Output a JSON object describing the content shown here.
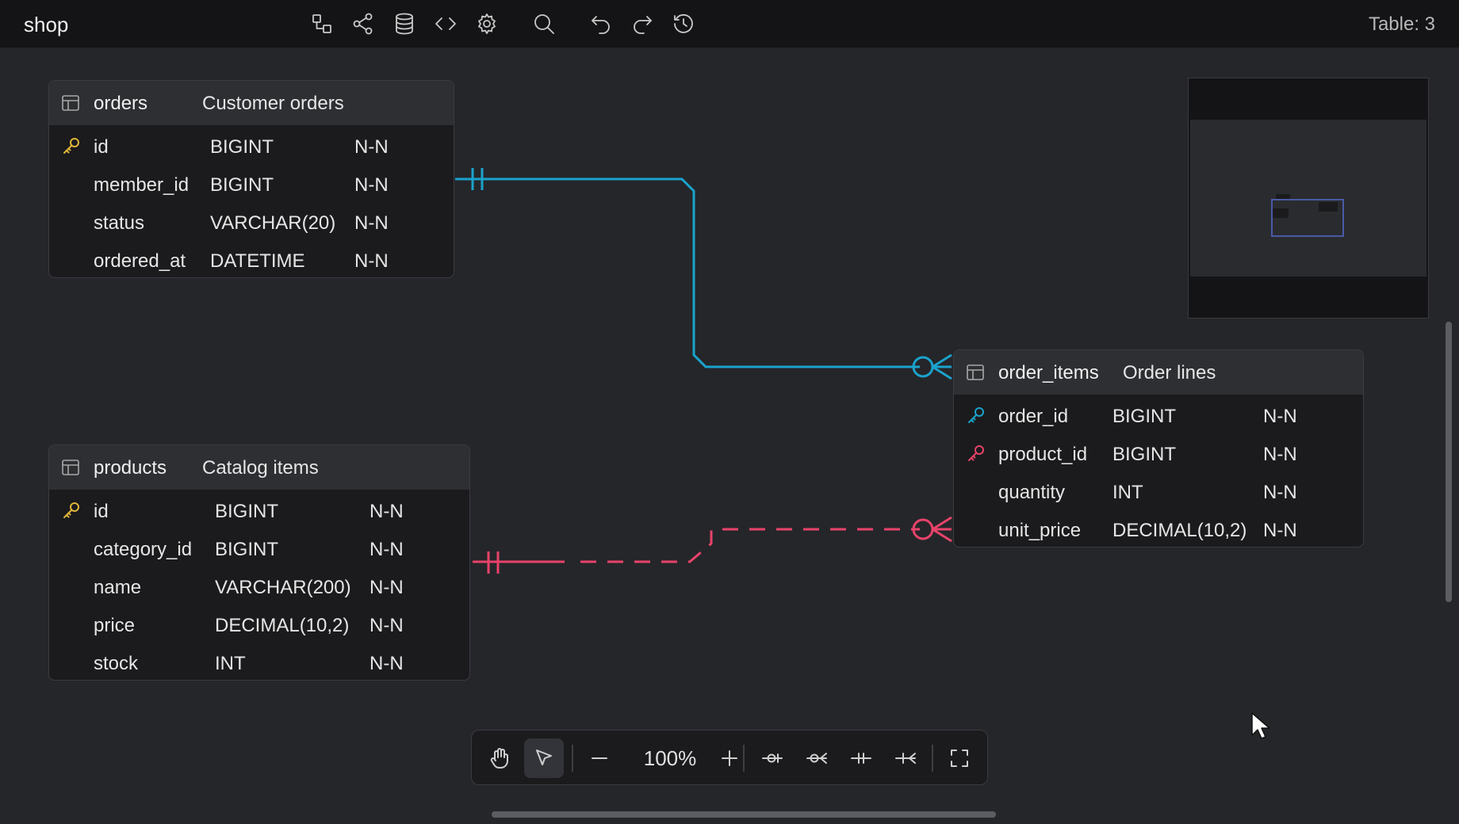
{
  "app": {
    "title": "shop",
    "table_count": "Table: 3"
  },
  "toolbar": {
    "icons": [
      "diagram-icon",
      "share-icon",
      "database-icon",
      "code-icon",
      "settings-icon",
      "search-icon",
      "undo-icon",
      "redo-icon",
      "history-icon"
    ]
  },
  "tables": {
    "orders": {
      "name": "orders",
      "comment": "Customer orders",
      "columns": [
        {
          "name": "id",
          "type": "BIGINT",
          "nullable": "N-N",
          "key": "primary"
        },
        {
          "name": "member_id",
          "type": "BIGINT",
          "nullable": "N-N",
          "key": ""
        },
        {
          "name": "status",
          "type": "VARCHAR(20)",
          "nullable": "N-N",
          "key": ""
        },
        {
          "name": "ordered_at",
          "type": "DATETIME",
          "nullable": "N-N",
          "key": ""
        }
      ]
    },
    "products": {
      "name": "products",
      "comment": "Catalog items",
      "columns": [
        {
          "name": "id",
          "type": "BIGINT",
          "nullable": "N-N",
          "key": "primary"
        },
        {
          "name": "category_id",
          "type": "BIGINT",
          "nullable": "N-N",
          "key": ""
        },
        {
          "name": "name",
          "type": "VARCHAR(200)",
          "nullable": "N-N",
          "key": ""
        },
        {
          "name": "price",
          "type": "DECIMAL(10,2)",
          "nullable": "N-N",
          "key": ""
        },
        {
          "name": "stock",
          "type": "INT",
          "nullable": "N-N",
          "key": ""
        }
      ]
    },
    "order_items": {
      "name": "order_items",
      "comment": "Order lines",
      "columns": [
        {
          "name": "order_id",
          "type": "BIGINT",
          "nullable": "N-N",
          "key": "foreign"
        },
        {
          "name": "product_id",
          "type": "BIGINT",
          "nullable": "N-N",
          "key": "foreign"
        },
        {
          "name": "quantity",
          "type": "INT",
          "nullable": "N-N",
          "key": ""
        },
        {
          "name": "unit_price",
          "type": "DECIMAL(10,2)",
          "nullable": "N-N",
          "key": ""
        }
      ]
    }
  },
  "relations": [
    {
      "from": "orders",
      "to": "order_items",
      "cardinality": "one-to-zero-or-many",
      "style": "solid",
      "color": "#1aa3cc"
    },
    {
      "from": "products",
      "to": "order_items",
      "cardinality": "one-to-zero-or-many",
      "style": "dashed",
      "color": "#e8436a"
    }
  ],
  "bottom_toolbar": {
    "zoom": "100%",
    "active_tool": "select"
  },
  "colors": {
    "primary_key": "#e0b53a",
    "fk_order": "#1aa3cc",
    "fk_product": "#e8436a",
    "minimap_viewport": "#4a5aa8"
  }
}
